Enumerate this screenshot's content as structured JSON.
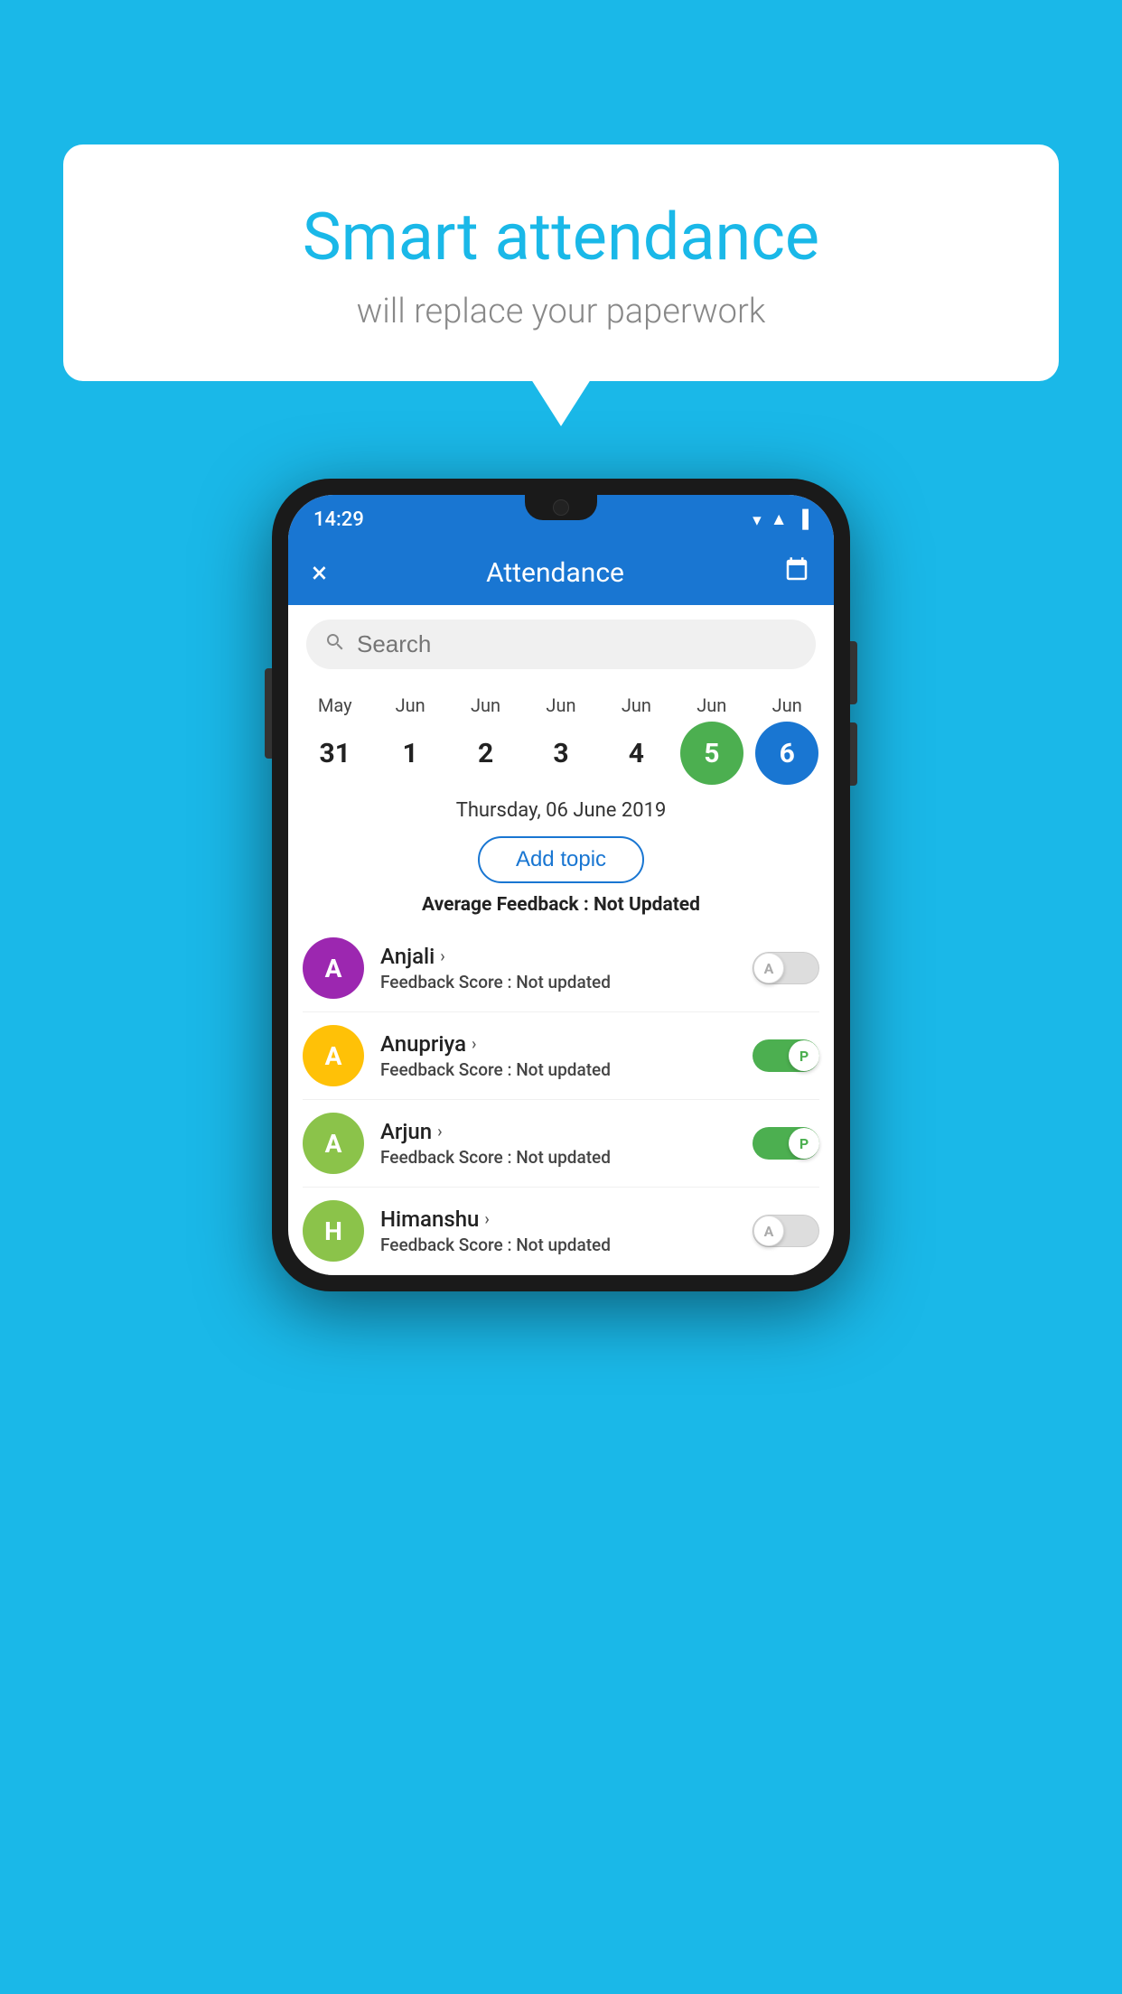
{
  "background_color": "#1ab8e8",
  "speech_bubble": {
    "title": "Smart attendance",
    "subtitle": "will replace your paperwork"
  },
  "status_bar": {
    "time": "14:29",
    "icons": [
      "wifi",
      "signal",
      "battery"
    ]
  },
  "app_bar": {
    "title": "Attendance",
    "close_label": "×",
    "calendar_label": "📅"
  },
  "search": {
    "placeholder": "Search"
  },
  "calendar": {
    "columns": [
      {
        "month": "May",
        "day": "31",
        "style": "normal"
      },
      {
        "month": "Jun",
        "day": "1",
        "style": "normal"
      },
      {
        "month": "Jun",
        "day": "2",
        "style": "normal"
      },
      {
        "month": "Jun",
        "day": "3",
        "style": "normal"
      },
      {
        "month": "Jun",
        "day": "4",
        "style": "normal"
      },
      {
        "month": "Jun",
        "day": "5",
        "style": "today"
      },
      {
        "month": "Jun",
        "day": "6",
        "style": "selected"
      }
    ]
  },
  "date_header": "Thursday, 06 June 2019",
  "add_topic_label": "Add topic",
  "avg_feedback_label": "Average Feedback : ",
  "avg_feedback_value": "Not Updated",
  "students": [
    {
      "name": "Anjali",
      "initial": "A",
      "avatar_color": "#9c27b0",
      "feedback": "Not updated",
      "toggle": "off",
      "toggle_label": "A"
    },
    {
      "name": "Anupriya",
      "initial": "A",
      "avatar_color": "#ffc107",
      "feedback": "Not updated",
      "toggle": "on",
      "toggle_label": "P"
    },
    {
      "name": "Arjun",
      "initial": "A",
      "avatar_color": "#8bc34a",
      "feedback": "Not updated",
      "toggle": "on",
      "toggle_label": "P"
    },
    {
      "name": "Himanshu",
      "initial": "H",
      "avatar_color": "#8bc34a",
      "feedback": "Not updated",
      "toggle": "off",
      "toggle_label": "A"
    }
  ],
  "feedback_score_label": "Feedback Score : "
}
